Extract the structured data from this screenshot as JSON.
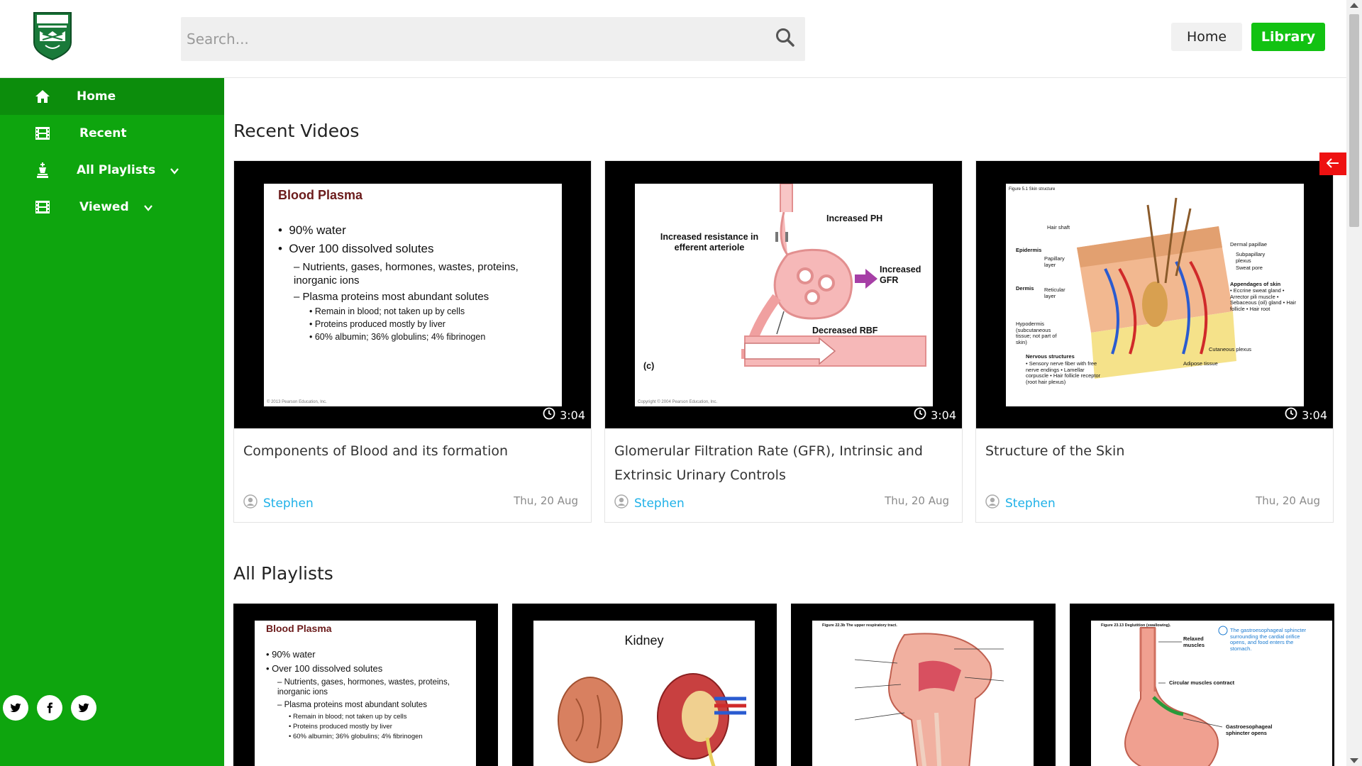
{
  "header": {
    "search_placeholder": "Search...",
    "nav_home": "Home",
    "nav_library": "Library"
  },
  "sidebar": {
    "items": [
      {
        "label": "Home"
      },
      {
        "label": "Recent"
      },
      {
        "label": "All Playlists"
      },
      {
        "label": "Viewed"
      }
    ]
  },
  "sections": {
    "recent_title": "Recent Videos",
    "playlists_title": "All Playlists"
  },
  "recent_videos": [
    {
      "title": "Components of Blood and its formation",
      "author": "Stephen",
      "date": "Thu, 20 Aug",
      "duration": "3:04"
    },
    {
      "title": "Glomerular Filtration Rate (GFR), Intrinsic and Extrinsic Urinary Controls",
      "author": "Stephen",
      "date": "Thu, 20 Aug",
      "duration": "3:04"
    },
    {
      "title": "Structure of the Skin",
      "author": "Stephen",
      "date": "Thu, 20 Aug",
      "duration": "3:04"
    }
  ],
  "slides": {
    "blood_plasma": {
      "title": "Blood Plasma",
      "l1a": "90% water",
      "l1b": "Over 100 dissolved solutes",
      "l2a": "Nutrients, gases, hormones, wastes, proteins, inorganic ions",
      "l2b": "Plasma proteins most abundant solutes",
      "l3a": "Remain in blood; not taken up by cells",
      "l3b": "Proteins produced mostly by liver",
      "l3c": "60% albumin; 36% globulins; 4% fibrinogen",
      "credit": "© 2013 Pearson Education, Inc."
    },
    "gfr": {
      "increased_ph": "Increased PH",
      "increased_resistance": "Increased resistance in efferent arteriole",
      "increased_gfr": "Increased GFR",
      "decreased_rbf": "Decreased RBF",
      "panel": "(c)",
      "credit": "Copyright © 2004 Pearson Education, Inc."
    },
    "skin": {
      "figure": "Figure 5.1 Skin structure",
      "hair_shaft": "Hair shaft",
      "epidermis": "Epidermis",
      "papillary": "Papillary layer",
      "dermis": "Dermis",
      "reticular": "Reticular layer",
      "hypodermis": "Hypodermis (subcutaneous tissue; not part of skin)",
      "nervous": "Nervous structures",
      "nervous_items": "• Sensory nerve fiber with free nerve endings • Lamellar corpuscle • Hair follicle receptor (root hair plexus)",
      "dermal_papillae": "Dermal papillae",
      "subpapillary": "Subpapillary plexus",
      "sweat_pore": "Sweat pore",
      "appendages": "Appendages of skin",
      "appendages_items": "• Eccrine sweat gland • Arrector pili muscle • Sebaceous (oil) gland • Hair follicle • Hair root",
      "cutaneous": "Cutaneous plexus",
      "adipose": "Adipose tissue"
    },
    "kidney": {
      "title": "Kidney"
    },
    "respiratory": {
      "figure": "Figure 22.3b The upper respiratory tract."
    },
    "stomach": {
      "figure": "Figure 23.13 Deglutition (swallowing).",
      "relaxed": "Relaxed muscles",
      "sphincter_note": "The gastroesophageal sphincter surrounding the cardial orifice opens, and food enters the stomach.",
      "circular": "Circular muscles contract",
      "gastro": "Gastroesophageal sphincter opens"
    }
  },
  "colors": {
    "sidebar_green": "#0ea50e",
    "library_green": "#12c212",
    "author_blue": "#1fb1e8",
    "arrow_red": "#ee1111"
  }
}
